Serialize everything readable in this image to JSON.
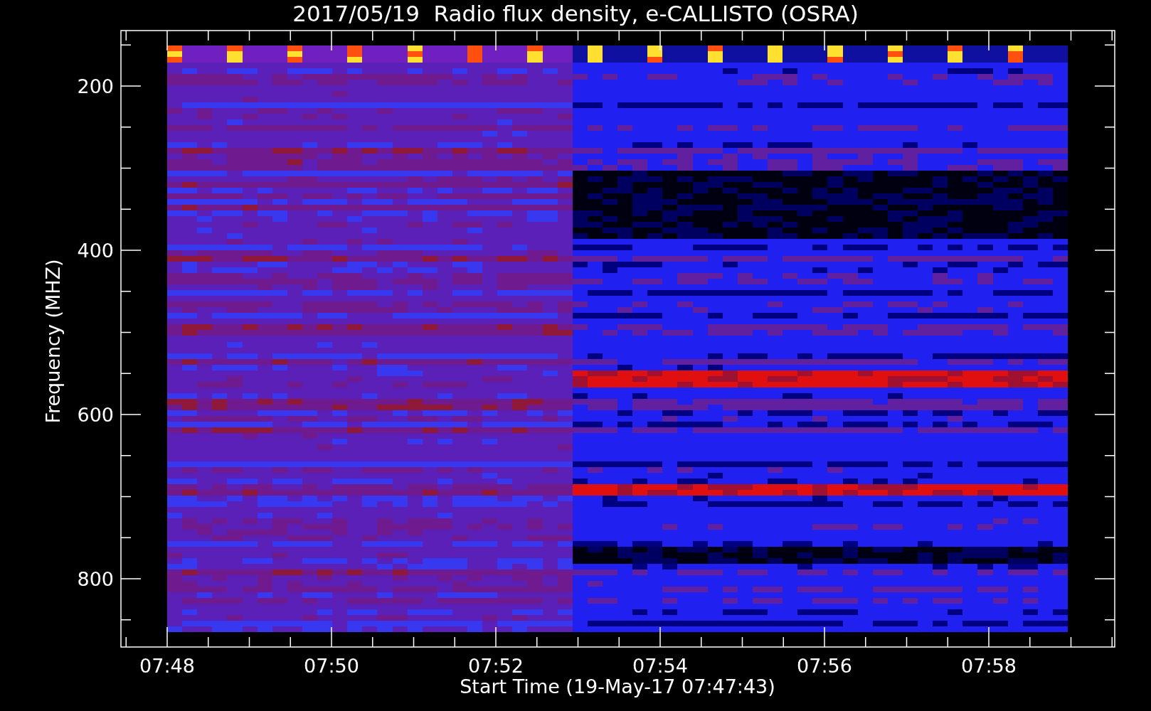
{
  "title": "2017/05/19  Radio flux density, e-CALLISTO (OSRA)",
  "y_axis": {
    "label": "Frequency (MHZ)",
    "ticks": [
      "200",
      "400",
      "600",
      "800"
    ]
  },
  "x_axis": {
    "label": "Start Time (19-May-17 07:47:43)",
    "ticks": [
      "07:48",
      "07:50",
      "07:52",
      "07:54",
      "07:56",
      "07:58"
    ]
  }
}
